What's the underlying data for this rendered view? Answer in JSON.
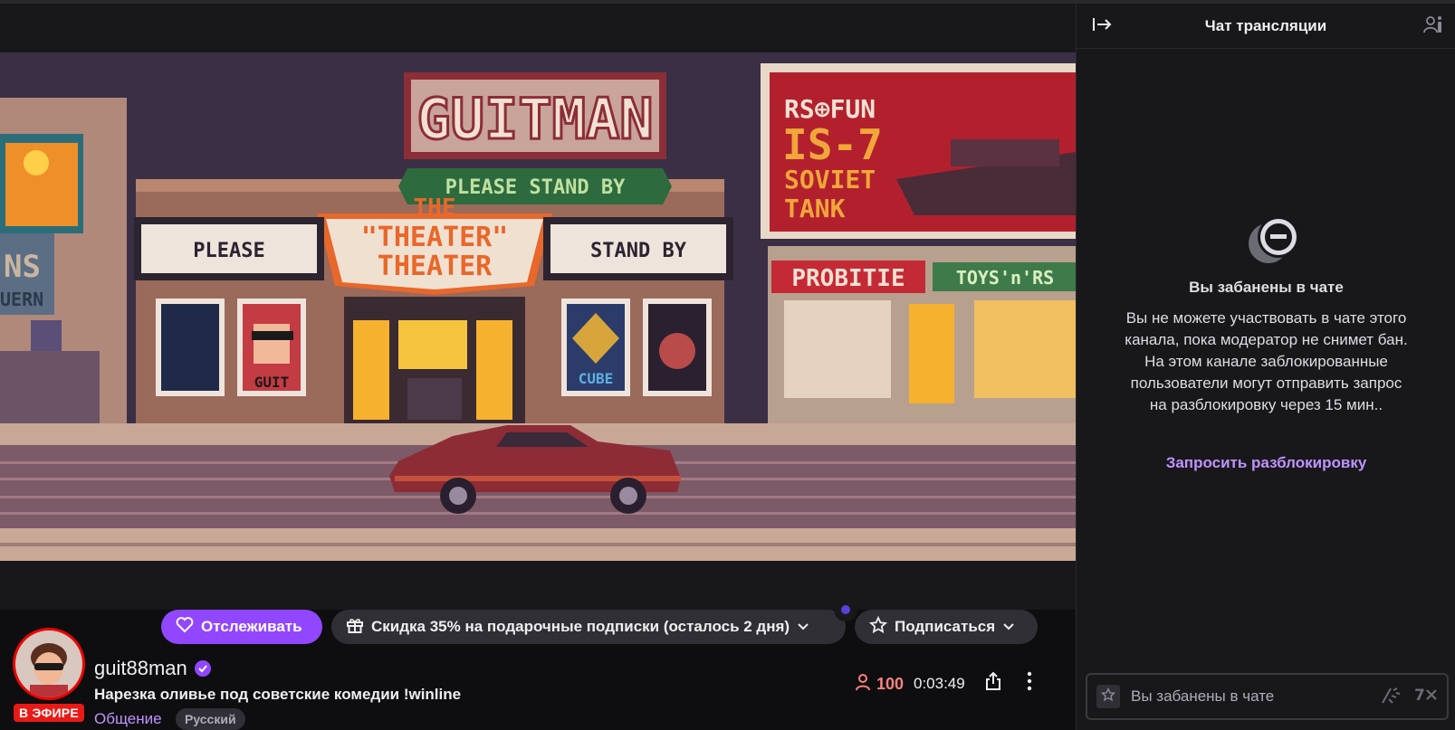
{
  "colors": {
    "accent": "#9147ff",
    "live": "#e91916",
    "link": "#bf94ff",
    "viewers": "#ff8280",
    "bg": "#0e0e10",
    "panel": "#18181b"
  },
  "video": {
    "marquee_title": "GUITMAN",
    "banner": "PLEASE STAND BY",
    "theater_line1": "\"THEATER\"",
    "theater_line2": "THEATER",
    "theater_top": "THE",
    "sign_left": "PLEASE",
    "sign_right": "STAND BY",
    "billboard_line1": "RS⊕FUN",
    "billboard_line2": "IS-7",
    "billboard_line3": "SOVIET",
    "billboard_line4": "TANK",
    "shop_left": "PROBITIE",
    "shop_right": "TOYS'n'RS",
    "poster_guit": "GUIT",
    "poster_cube": "CUBE"
  },
  "channel": {
    "name": "guit88man",
    "live_label": "В ЭФИРЕ",
    "stream_title": "Нарезка оливье под советские комедии !winline",
    "category": "Общение",
    "tag": "Русский",
    "viewers": "100",
    "uptime": "0:03:49"
  },
  "actions": {
    "follow_label": "Отслеживать",
    "gift_label": "Скидка 35% на подарочные подписки (осталось 2 дня)",
    "subscribe_label": "Подписаться"
  },
  "chat": {
    "title": "Чат трансляции",
    "ban_title": "Вы забанены в чате",
    "ban_text": "Вы не можете участвовать в чате этого канала, пока модератор не снимет бан. На этом канале заблокированные пользователи могут отправить запрос на разблокировку через 15 мин..",
    "unban_link": "Запросить разблокировку",
    "input_placeholder": "Вы забанены в чате"
  },
  "icons": [
    "heart-icon",
    "gift-icon",
    "chevron-down-icon",
    "star-icon",
    "verified-icon",
    "viewers-icon",
    "share-icon",
    "more-icon",
    "collapse-icon",
    "users-icon",
    "ban-icon",
    "bits-icon",
    "emote-icon"
  ]
}
